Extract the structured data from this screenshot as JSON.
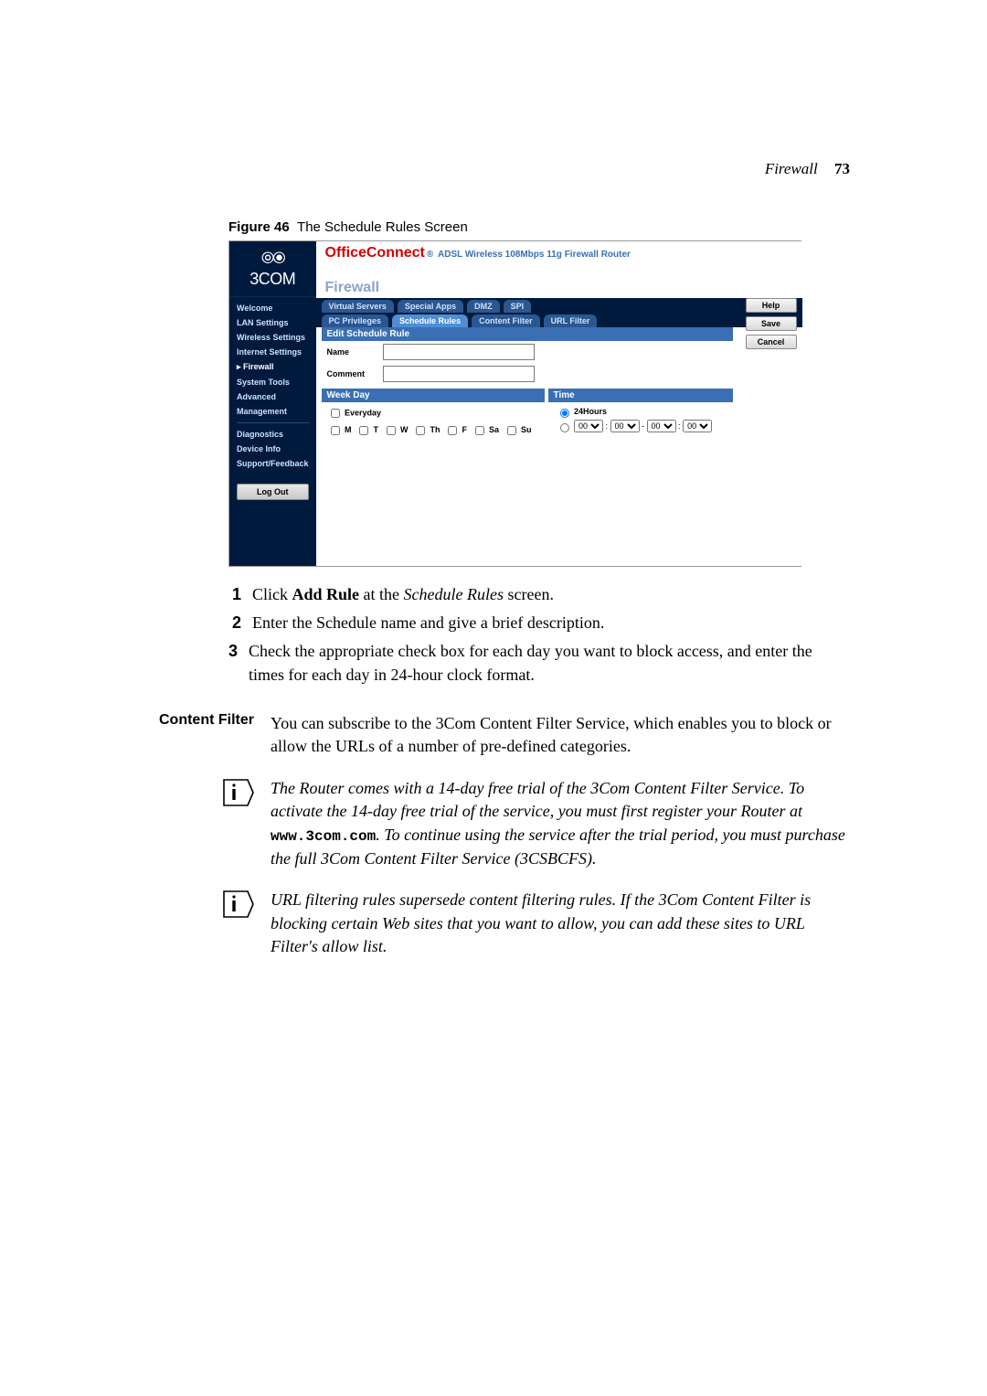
{
  "header": {
    "section": "Firewall",
    "page": "73"
  },
  "figure": {
    "label": "Figure 46",
    "caption": "The Schedule Rules Screen"
  },
  "shot": {
    "brand_icon": "⦾⦿",
    "brand": "3COM",
    "product": "OfficeConnect",
    "product_sub": "ADSL Wireless 108Mbps 11g Firewall Router",
    "crumb": "Firewall",
    "nav": [
      "Welcome",
      "LAN Settings",
      "Wireless Settings",
      "Internet Settings",
      "Firewall",
      "System Tools",
      "Advanced",
      "Management"
    ],
    "nav2": [
      "Diagnostics",
      "Device Info",
      "Support/Feedback"
    ],
    "logout": "Log Out",
    "tabs_row1": [
      "Virtual Servers",
      "Special Apps",
      "DMZ",
      "SPI"
    ],
    "tabs_row2": [
      "PC Privileges",
      "Schedule Rules",
      "Content Filter",
      "URL Filter"
    ],
    "panel_title": "Edit Schedule Rule",
    "name_label": "Name",
    "comment_label": "Comment",
    "weekday_hd": "Week Day",
    "time_hd": "Time",
    "everyday": "Everyday",
    "days": [
      "M",
      "T",
      "W",
      "Th",
      "F",
      "Sa",
      "Su"
    ],
    "time_24h": "24Hours",
    "buttons": {
      "help": "Help",
      "save": "Save",
      "cancel": "Cancel"
    }
  },
  "steps": [
    {
      "n": "1",
      "html_pre": "Click ",
      "bold": "Add Rule",
      "mid": " at the ",
      "ital": "Schedule Rules",
      "post": " screen."
    },
    {
      "n": "2",
      "text": "Enter the Schedule name and give a brief description."
    },
    {
      "n": "3",
      "text": "Check the appropriate check box for each day you want to block access, and enter the times for each day in 24-hour clock format."
    }
  ],
  "content_filter": {
    "label": "Content Filter",
    "text": "You can subscribe to the 3Com Content Filter Service, which enables you to block or allow the URLs of a number of pre-defined categories."
  },
  "note1": {
    "pre": "The Router comes with a 14-day free trial of the 3Com Content Filter Service. To activate the 14-day free trial of the service, you must first register your Router at ",
    "url": "www.3com.com",
    "post": ". To continue using the service after the trial period, you must purchase the full 3Com Content Filter Service (3CSBCFS)."
  },
  "note2": "URL filtering rules supersede content filtering rules. If the 3Com Content Filter is blocking certain Web sites that you want to allow, you can add these sites to URL Filter's allow list."
}
